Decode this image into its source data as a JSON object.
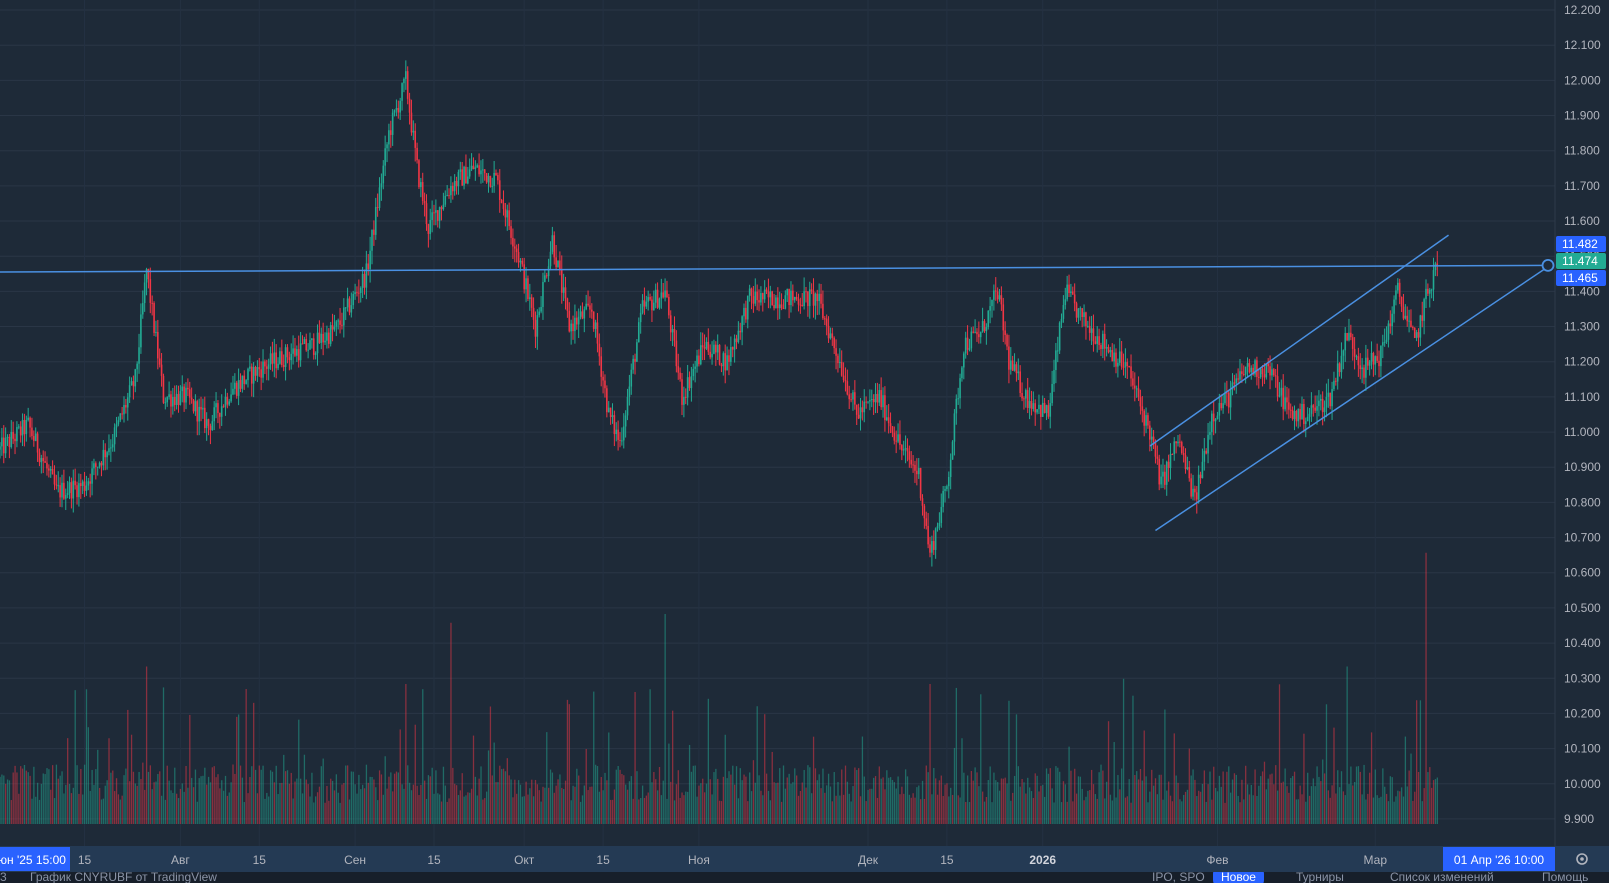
{
  "chart_data": {
    "type": "candlestick",
    "title": "",
    "price_axis": {
      "ticks": [
        "12.200",
        "12.100",
        "12.000",
        "11.900",
        "11.800",
        "11.700",
        "11.600",
        "11.500",
        "11.400",
        "11.300",
        "11.200",
        "11.100",
        "11.000",
        "10.900",
        "10.800",
        "10.700",
        "10.600",
        "10.500",
        "10.400",
        "10.300",
        "10.200",
        "10.100",
        "10.000",
        "9.900"
      ],
      "ylim": [
        9.86,
        12.22
      ]
    },
    "time_axis": {
      "ticks": [
        {
          "label": "15",
          "bold": false
        },
        {
          "label": "Авг",
          "bold": false
        },
        {
          "label": "15",
          "bold": false
        },
        {
          "label": "Сен",
          "bold": false
        },
        {
          "label": "15",
          "bold": false
        },
        {
          "label": "Окт",
          "bold": false
        },
        {
          "label": "15",
          "bold": false
        },
        {
          "label": "Ноя",
          "bold": false
        },
        {
          "label": "Дек",
          "bold": false
        },
        {
          "label": "15",
          "bold": false
        },
        {
          "label": "2026",
          "bold": true
        },
        {
          "label": "Фев",
          "bold": false
        },
        {
          "label": "Мар",
          "bold": false
        }
      ],
      "left_edge_label": "юн '25  15:00",
      "crosshair_label": "01 Апр '26  10:00"
    },
    "price_tags": [
      {
        "value": "11.482",
        "color": "#2962ff"
      },
      {
        "value": "11.474",
        "color": "#22ab94"
      },
      {
        "value": "11.465",
        "color": "#2962ff"
      }
    ],
    "price_path": [
      {
        "t": "2025-06-30",
        "close": 10.95
      },
      {
        "t": "2025-07-05",
        "close": 11.02
      },
      {
        "t": "2025-07-10",
        "close": 10.83
      },
      {
        "t": "2025-07-15",
        "close": 10.85
      },
      {
        "t": "2025-07-20",
        "close": 10.98
      },
      {
        "t": "2025-07-24",
        "close": 11.15
      },
      {
        "t": "2025-07-26",
        "close": 11.46
      },
      {
        "t": "2025-07-29",
        "close": 11.1
      },
      {
        "t": "2025-08-02",
        "close": 11.1
      },
      {
        "t": "2025-08-06",
        "close": 11.02
      },
      {
        "t": "2025-08-10",
        "close": 11.12
      },
      {
        "t": "2025-08-15",
        "close": 11.18
      },
      {
        "t": "2025-08-20",
        "close": 11.22
      },
      {
        "t": "2025-08-25",
        "close": 11.25
      },
      {
        "t": "2025-08-29",
        "close": 11.3
      },
      {
        "t": "2025-09-03",
        "close": 11.45
      },
      {
        "t": "2025-09-07",
        "close": 11.85
      },
      {
        "t": "2025-09-10",
        "close": 12.0
      },
      {
        "t": "2025-09-12",
        "close": 11.75
      },
      {
        "t": "2025-09-14",
        "close": 11.58
      },
      {
        "t": "2025-09-18",
        "close": 11.7
      },
      {
        "t": "2025-09-22",
        "close": 11.75
      },
      {
        "t": "2025-09-26",
        "close": 11.72
      },
      {
        "t": "2025-09-30",
        "close": 11.5
      },
      {
        "t": "2025-10-03",
        "close": 11.3
      },
      {
        "t": "2025-10-06",
        "close": 11.55
      },
      {
        "t": "2025-10-09",
        "close": 11.3
      },
      {
        "t": "2025-10-13",
        "close": 11.35
      },
      {
        "t": "2025-10-16",
        "close": 11.05
      },
      {
        "t": "2025-10-18",
        "close": 10.97
      },
      {
        "t": "2025-10-22",
        "close": 11.35
      },
      {
        "t": "2025-10-26",
        "close": 11.4
      },
      {
        "t": "2025-10-29",
        "close": 11.1
      },
      {
        "t": "2025-11-02",
        "close": 11.25
      },
      {
        "t": "2025-11-06",
        "close": 11.2
      },
      {
        "t": "2025-11-10",
        "close": 11.38
      },
      {
        "t": "2025-11-16",
        "close": 11.38
      },
      {
        "t": "2025-11-22",
        "close": 11.38
      },
      {
        "t": "2025-11-26",
        "close": 11.2
      },
      {
        "t": "2025-11-29",
        "close": 11.05
      },
      {
        "t": "2025-12-03",
        "close": 11.1
      },
      {
        "t": "2025-12-07",
        "close": 10.95
      },
      {
        "t": "2025-12-10",
        "close": 10.88
      },
      {
        "t": "2025-12-12",
        "close": 10.65
      },
      {
        "t": "2025-12-15",
        "close": 10.85
      },
      {
        "t": "2025-12-18",
        "close": 11.25
      },
      {
        "t": "2025-12-21",
        "close": 11.28
      },
      {
        "t": "2025-12-24",
        "close": 11.4
      },
      {
        "t": "2025-12-26",
        "close": 11.2
      },
      {
        "t": "2025-12-29",
        "close": 11.1
      },
      {
        "t": "2026-01-02",
        "close": 11.05
      },
      {
        "t": "2026-01-05",
        "close": 11.4
      },
      {
        "t": "2026-01-08",
        "close": 11.32
      },
      {
        "t": "2026-01-12",
        "close": 11.25
      },
      {
        "t": "2026-01-16",
        "close": 11.18
      },
      {
        "t": "2026-01-20",
        "close": 11.0
      },
      {
        "t": "2026-01-22",
        "close": 10.85
      },
      {
        "t": "2026-01-25",
        "close": 10.98
      },
      {
        "t": "2026-01-28",
        "close": 10.8
      },
      {
        "t": "2026-01-31",
        "close": 11.05
      },
      {
        "t": "2026-02-03",
        "close": 11.1
      },
      {
        "t": "2026-02-06",
        "close": 11.18
      },
      {
        "t": "2026-02-10",
        "close": 11.18
      },
      {
        "t": "2026-02-14",
        "close": 11.05
      },
      {
        "t": "2026-02-17",
        "close": 11.05
      },
      {
        "t": "2026-02-21",
        "close": 11.1
      },
      {
        "t": "2026-02-24",
        "close": 11.28
      },
      {
        "t": "2026-02-27",
        "close": 11.18
      },
      {
        "t": "2026-03-02",
        "close": 11.22
      },
      {
        "t": "2026-03-05",
        "close": 11.4
      },
      {
        "t": "2026-03-08",
        "close": 11.25
      },
      {
        "t": "2026-03-10",
        "close": 11.38
      },
      {
        "t": "2026-03-12",
        "close": 11.48
      }
    ],
    "volume_spikes": [
      {
        "t": "2025-07-26",
        "level": 0.9
      },
      {
        "t": "2025-09-10",
        "level": 0.8
      },
      {
        "t": "2025-09-18",
        "level": 1.15
      },
      {
        "t": "2025-10-26",
        "level": 1.2
      },
      {
        "t": "2025-12-12",
        "level": 0.8
      },
      {
        "t": "2026-02-24",
        "level": 0.9
      },
      {
        "t": "2026-03-10",
        "level": 1.55
      }
    ],
    "drawings": {
      "horizontal_line": {
        "t1": "2025-06-30",
        "p1": 11.455,
        "t2": "2026-04-01",
        "p2": 11.474
      },
      "channel_upper": {
        "t1": "2026-01-20",
        "p1": 10.96,
        "t2": "2026-03-14",
        "p2": 11.56
      },
      "channel_lower": {
        "t1": "2026-01-21",
        "p1": 10.72,
        "t2": "2026-04-01",
        "p2": 11.47
      }
    },
    "colors": {
      "up": "#22ab94",
      "down": "#f23645",
      "line": "#4a90e2"
    }
  },
  "bottom_bar": {
    "left_num": "3",
    "chart_caption": "График CNYRUBF от TradingView",
    "ipo_link": "IPO, SPO",
    "new_badge": "Новое",
    "tournaments": "Турниры",
    "changelog": "Список изменений",
    "help": "Помощь"
  }
}
